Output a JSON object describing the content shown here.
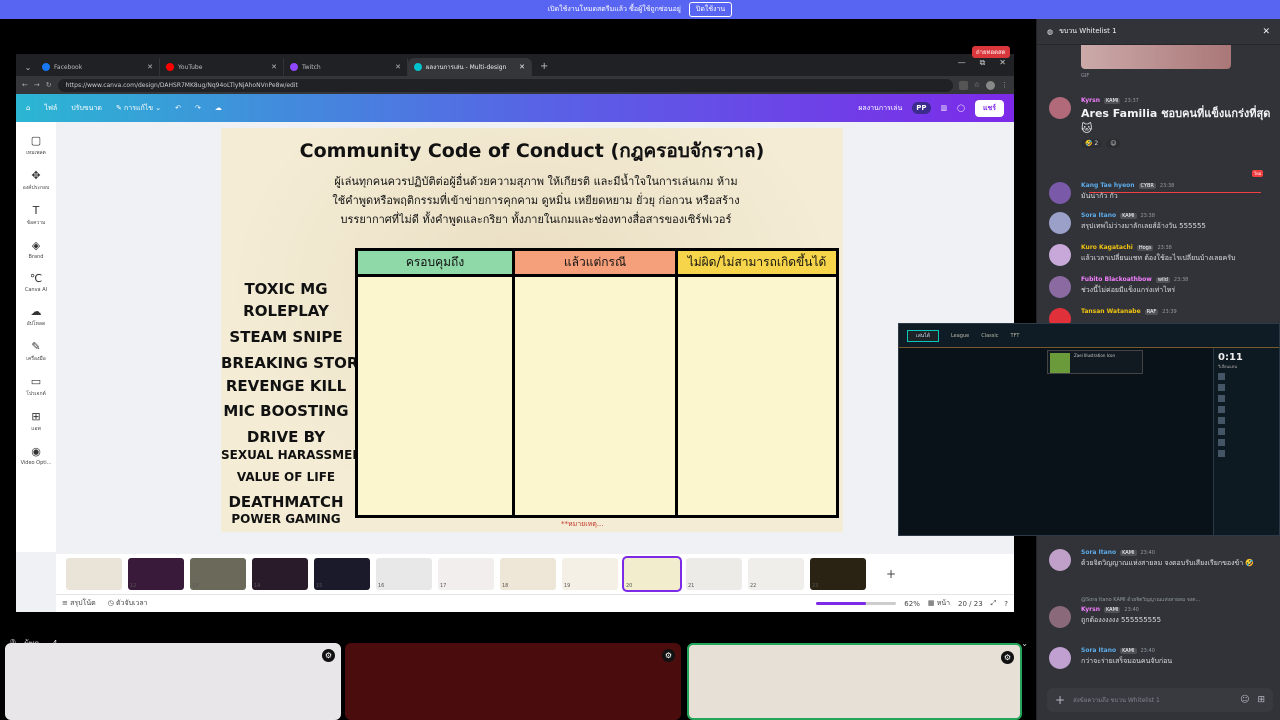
{
  "topbar": {
    "text": "เปิดใช้งานโหมดสตรีมแล้ว ซื้อผู้ใช้ถูกซ่อนอยู่",
    "button": "ปิดใช้งาน"
  },
  "live_badge": "ถ่ายทอดสด",
  "browser": {
    "tabs": [
      {
        "label": "Facebook",
        "color": "#1877f2"
      },
      {
        "label": "YouTube",
        "color": "#ff0000"
      },
      {
        "label": "Twitch",
        "color": "#9146ff"
      },
      {
        "label": "ผลงานการเล่น - Multi-design",
        "color": "#00c4cc"
      }
    ],
    "url": "https://www.canva.com/design/DAHSR7MK8ug/Nq94oLTlyNjAhoNVnPe8w/edit"
  },
  "canva": {
    "menu": [
      "ไฟล์",
      "ปรับขนาด",
      "การแก้ไข"
    ],
    "doc_title": "ผลงานการเล่น",
    "avatar": "PP",
    "share": "แชร์",
    "nav": [
      {
        "icon": "▢",
        "label": "เทมเพลต"
      },
      {
        "icon": "✥",
        "label": "องค์ประกอบ"
      },
      {
        "icon": "T",
        "label": "ข้อความ"
      },
      {
        "icon": "◈",
        "label": "Brand"
      },
      {
        "icon": "℃",
        "label": "Canva AI"
      },
      {
        "icon": "☁",
        "label": "อัปโหลด"
      },
      {
        "icon": "✎",
        "label": "เครื่องมือ"
      },
      {
        "icon": "▭",
        "label": "โปรเจกต์"
      },
      {
        "icon": "⊞",
        "label": "แอพ"
      },
      {
        "icon": "◉",
        "label": "Video Opti..."
      }
    ],
    "footer": {
      "notes": "สรุปโน้ต",
      "timer": "ตัวจับเวลา",
      "zoom": "62%",
      "page_btn": "หน้า",
      "pages": "20 / 23",
      "zoom_fraction": 0.62
    },
    "thumbs": [
      "",
      "12",
      "13",
      "14",
      "15",
      "16",
      "17",
      "18",
      "19",
      "20",
      "21",
      "22",
      "23"
    ]
  },
  "slide": {
    "title": "Community Code of Conduct (กฎครอบจักรวาล)",
    "desc": "ผู้เล่นทุกคนควรปฏิบัติต่อผู้อื่นด้วยความสุภาพ ให้เกียรติ และมีน้ำใจในการเล่นเกม ห้ามใช้คำพูดหรือพฤติกรรมที่เข้าข่ายการคุกคาม ดูหมิ่น เหยียดหยาม ยั่วยุ ก่อกวน หรือสร้างบรรยากาศที่ไม่ดี ทั้งคำพูดและกริยา ทั้งภายในเกมและช่องทางสื่อสารของเซิร์ฟเวอร์",
    "columns": [
      {
        "label": "ครอบคุมถึง",
        "color": "#8fd9a8"
      },
      {
        "label": "แล้วแต่กรณี",
        "color": "#f5a07a"
      },
      {
        "label": "ไม่ผิด/ไม่สามารถเกิดขึ้นได้",
        "color": "#f7d54a"
      }
    ],
    "labels": [
      "TOXIC    MG",
      "ROLEPLAY",
      "STEAM SNIPE",
      "BREAKING STORY",
      "REVENGE KILL",
      "MIC BOOSTING",
      "DRIVE BY",
      "SEXUAL HARASSMENT",
      "VALUE OF LIFE",
      "DEATHMATCH",
      "POWER GAMING"
    ],
    "footnote": "**หมายเหตุ..."
  },
  "overlay": {
    "play": "เล่นได้",
    "modes": [
      "League",
      "Classic",
      "TFT"
    ],
    "notice_title": "Zaei Illustration Icon",
    "timer": "0:11",
    "status": "วีเลี่ยนแทน"
  },
  "voice": {
    "header": "ผู้พูด — 4"
  },
  "chat": {
    "title": "ขบวน Whitelist 1",
    "gif_label": "GIF",
    "new_badge": "ใหม่",
    "messages": [
      {
        "name": "Kyrsn",
        "name_color": "#f47fff",
        "tag": "KAMI",
        "time": "23:37",
        "text": "Ares Familia ชอบคนที่แข็งแกร่งที่สุด 🐱",
        "big": true,
        "reaction": "🤣 2"
      },
      {
        "name": "Kang Tae hyeon",
        "name_color": "#5dadec",
        "tag": "CYBR",
        "time": "23:38",
        "text": "มันน่ากัว กัว"
      },
      {
        "name": "Sora Itano",
        "name_color": "#5dadec",
        "tag": "KAMI",
        "time": "23:38",
        "text": "สรุปเทพไม่ว่างมาลักเลยส์อ้างวัน 555555"
      },
      {
        "name": "Kuro Kagatachi",
        "name_color": "#f1c40f",
        "tag": "Hogs",
        "time": "23:38",
        "text": "แล้วเวลาเปลี่ยนแชท ต้องใช้อะไรเปลี่ยนบ้างเลยครับ"
      },
      {
        "name": "Fubito Blackoathbow",
        "name_color": "#f47fff",
        "tag": "wild",
        "time": "23:38",
        "text": "ช่วงนี้ไม่ค่อยมีแข็งแกร่งเท่าไหร่"
      },
      {
        "name": "Tansan Watanabe",
        "name_color": "#f1c40f",
        "tag": "RAF",
        "time": "23:39",
        "text": ""
      },
      {
        "name": "Sora Itano",
        "name_color": "#5dadec",
        "tag": "KAMI",
        "time": "23:40",
        "text": "ด้วยจิตวิญญาณแห่งสายลม จงตอบรับเสียงเรียกของข้า 🤣"
      },
      {
        "name": "Kyrsn",
        "name_color": "#f47fff",
        "tag": "KAMI",
        "time": "23:40",
        "text": "ถูกต้องงงงงง 555555555",
        "reply": "@Sora Itano KAMI ด้วยจิตวิญญาณแห่งสายลม จงต..."
      },
      {
        "name": "Sora Itano",
        "name_color": "#5dadec",
        "tag": "KAMI",
        "time": "23:40",
        "text": "กว่าจะร่ายเสร็จมอนคนจับก่อน"
      }
    ],
    "input_placeholder": "ส่งข้อความถึง ขบวน Whitelist 1"
  }
}
